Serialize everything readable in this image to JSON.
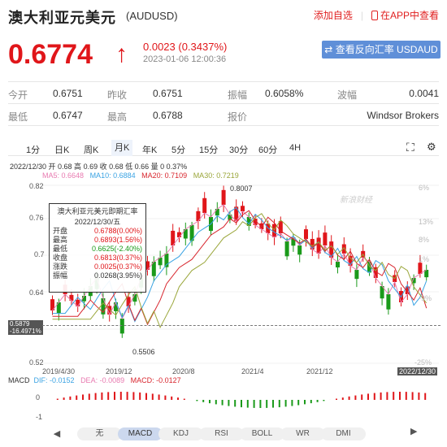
{
  "header": {
    "title": "澳大利亚元美元",
    "code": "(AUDUSD)",
    "watchlist_label": "添加自选",
    "app_label": "在APP中查看",
    "price": "0.6774",
    "change": "0.0023 (0.3437%)",
    "timestamp": "2023-01-06 12:00:36",
    "reverse_button": "查看反向汇率 USDAUD"
  },
  "stats": {
    "row1": [
      {
        "label": "今开",
        "value": "0.6751"
      },
      {
        "label": "昨收",
        "value": "0.6751"
      },
      {
        "label": "振幅",
        "value": "0.6058%"
      },
      {
        "label": "波幅",
        "value": "0.0041"
      }
    ],
    "row2": [
      {
        "label": "最低",
        "value": "0.6747"
      },
      {
        "label": "最高",
        "value": "0.6788"
      },
      {
        "label": "报价",
        "value": "Windsor Brokers"
      }
    ]
  },
  "tabs": [
    "1分",
    "日K",
    "周K",
    "月K",
    "年K",
    "5分",
    "15分",
    "30分",
    "60分",
    "4H"
  ],
  "active_tab": "月K",
  "chart_info": {
    "ohlc": "2022/12/30 开 0.68 高 0.69 收 0.68 低 0.66 量 0 0.37%",
    "ma5": "MA5: 0.6648",
    "ma10": "MA10: 0.6884",
    "ma20": "MA20: 0.7109",
    "ma30": "MA30: 0.7219",
    "macd": "MACD",
    "dif": "DIF: -0.0152",
    "dea": "DEA: -0.0089",
    "macd_val": "MACD: -0.0127",
    "watermark": "新浪财经",
    "cursor_price": "0.5879",
    "cursor_pct": "-16.4971%",
    "high_label": "0.8007",
    "low_label": "0.5506"
  },
  "tooltip": {
    "title": "澳大利亚元美元即期汇率",
    "date": "2022/12/30/五",
    "rows": [
      {
        "label": "开盘",
        "value": "0.6788(0.00%)",
        "color": "red"
      },
      {
        "label": "最高",
        "value": "0.6893(1.56%)",
        "color": "red"
      },
      {
        "label": "最低",
        "value": "0.6625(-2.40%)",
        "color": "green"
      },
      {
        "label": "收盘",
        "value": "0.6813(0.37%)",
        "color": "red"
      },
      {
        "label": "涨跌",
        "value": "0.0025(0.37%)",
        "color": "red"
      },
      {
        "label": "振幅",
        "value": "0.0268(3.95%)",
        "color": "black"
      }
    ]
  },
  "y_labels": [
    "0.82",
    "0.76",
    "0.7",
    "0.64",
    "0.58",
    "0.52"
  ],
  "pct_labels": [
    "6%",
    "13%",
    "8%",
    "1%",
    "-9%",
    "-25%"
  ],
  "x_labels": [
    "2019/4/30",
    "2019/12",
    "2020/8",
    "2021/4",
    "2021/12",
    "2022/12/30"
  ],
  "macd_labels": [
    "0",
    "-1"
  ],
  "indicator_tabs": [
    "无",
    "MACD",
    "KDJ",
    "RSI",
    "BOLL",
    "WR",
    "DMI"
  ],
  "active_indicator": "MACD",
  "colors": {
    "up": "#e0161a",
    "down": "#1a9a1a",
    "ma5": "#e87ab0",
    "ma10": "#3aa3e3",
    "ma20": "#d8262e",
    "ma30": "#9aa63a"
  }
}
